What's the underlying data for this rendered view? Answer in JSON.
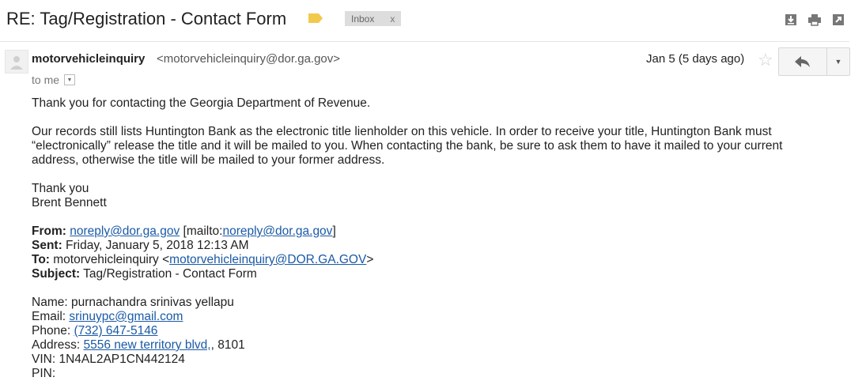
{
  "header": {
    "subject": "RE: Tag/Registration - Contact Form",
    "label_text": "Inbox",
    "label_remove": "x",
    "icons": [
      "download-icon",
      "print-icon",
      "new-window-icon"
    ]
  },
  "message": {
    "sender_name": "motorvehicleinquiry",
    "sender_email": "<motorvehicleinquiry@dor.ga.gov>",
    "to_text": "to me",
    "date": "Jan 5 (5 days ago)"
  },
  "body": {
    "greeting": "Thank you for contacting the Georgia Department of Revenue.",
    "para_line1": "Our records still lists Huntington Bank as the electronic title lienholder on this vehicle.  In order to receive your title, Huntington Bank must",
    "para_line2": "“electronically” release the title and it will be mailed to you.  When contacting the bank,  be sure to ask them to have it mailed to your current",
    "para_line3": "address, otherwise the title will be mailed to your former address.",
    "closing": "Thank you",
    "signature": "Brent Bennett",
    "from_label": "From:",
    "from_email": "noreply@dor.ga.gov",
    "from_mailto_prefix": " [mailto:",
    "from_mailto_link": "noreply@dor.ga.gov",
    "from_mailto_suffix": "]",
    "sent_label": "Sent:",
    "sent_value": " Friday, January 5, 2018 12:13 AM",
    "to_label": "To:",
    "to_value_prefix": " motorvehicleinquiry <",
    "to_value_link": "motorvehicleinquiry@DOR.GA.GOV",
    "to_value_suffix": ">",
    "subject_label": "Subject:",
    "subject_value": " Tag/Registration - Contact Form",
    "name_line": "Name: purnachandra srinivas yellapu",
    "email_label": "Email: ",
    "email_link": "srinuypc@gmail.com",
    "phone_label": "Phone: ",
    "phone_link": "(732) 647-5146",
    "address_label": "Address: ",
    "address_link": "5556 new territory blvd,",
    "address_suffix": ", 8101",
    "vin_line": "VIN: 1N4AL2AP1CN442124",
    "pin_line": "PIN:"
  },
  "colors": {
    "link": "#1a5aa6",
    "label_tag": "#f2c94c",
    "inbox_bg": "#dddddd"
  }
}
